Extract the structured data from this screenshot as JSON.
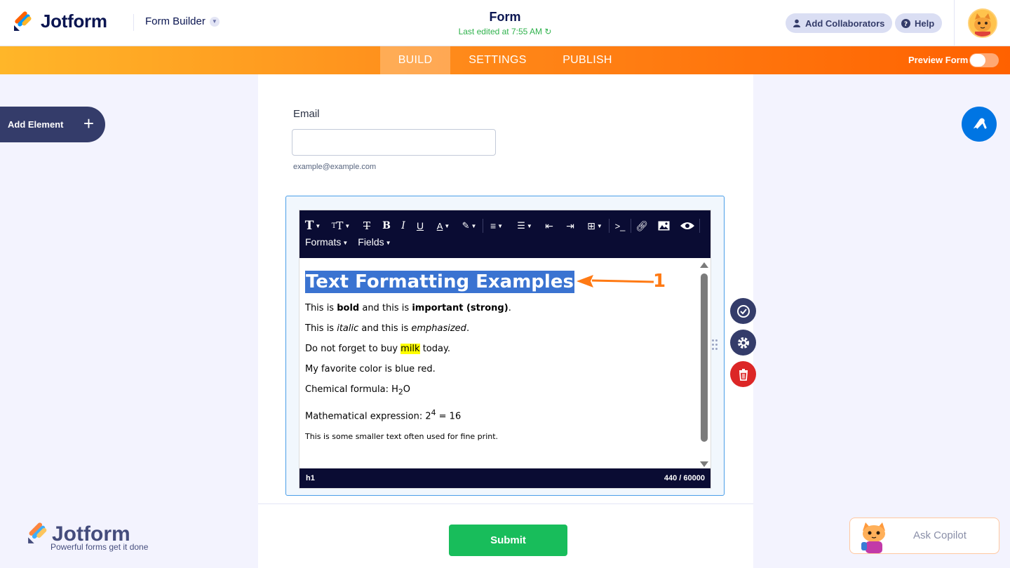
{
  "header": {
    "brand": "Jotform",
    "builder_label": "Form Builder",
    "form_title": "Form",
    "last_edited": "Last edited at 7:55 AM",
    "add_collaborators": "Add Collaborators",
    "help": "Help"
  },
  "nav": {
    "tabs": [
      "BUILD",
      "SETTINGS",
      "PUBLISH"
    ],
    "active_tab": "BUILD",
    "preview_label": "Preview Form",
    "preview_on": false
  },
  "sidebar": {
    "add_element": "Add Element"
  },
  "form": {
    "email_label": "Email",
    "email_value": "",
    "email_sublabel": "example@example.com",
    "submit_label": "Submit"
  },
  "editor": {
    "toolbar_row2": [
      "Formats",
      "Fields"
    ],
    "heading": "Text Formatting Examples",
    "lines": {
      "bold": {
        "pre": "This is ",
        "b": "bold",
        "mid": " and this is ",
        "strong": "important (strong)",
        "post": "."
      },
      "italic": {
        "pre": "This is ",
        "i": "italic",
        "mid": " and this is ",
        "em": "emphasized",
        "post": "."
      },
      "mark": {
        "pre": "Do not forget to buy ",
        "mark": "milk",
        "post": " today."
      },
      "color": "My favorite color is blue red.",
      "chem": {
        "pre": "Chemical formula: H",
        "sub": "2",
        "post": "O"
      },
      "math": {
        "pre": "Mathematical expression: 2",
        "sup": "4",
        "post": " = 16"
      },
      "small": "This is some smaller text often used for fine print."
    },
    "status_path": "h1",
    "char_count": "440 / 60000"
  },
  "annotation": {
    "number": "1",
    "color": "#ff7a14"
  },
  "watermark": {
    "brand": "Jotform",
    "tagline": "Powerful forms get it done"
  },
  "copilot": {
    "label": "Ask Copilot"
  },
  "colors": {
    "accent_orange": "#ff6100",
    "navy": "#0a1551",
    "submit_green": "#18bd5b",
    "fab_blue": "#0075e3",
    "delete_red": "#dc2626"
  }
}
